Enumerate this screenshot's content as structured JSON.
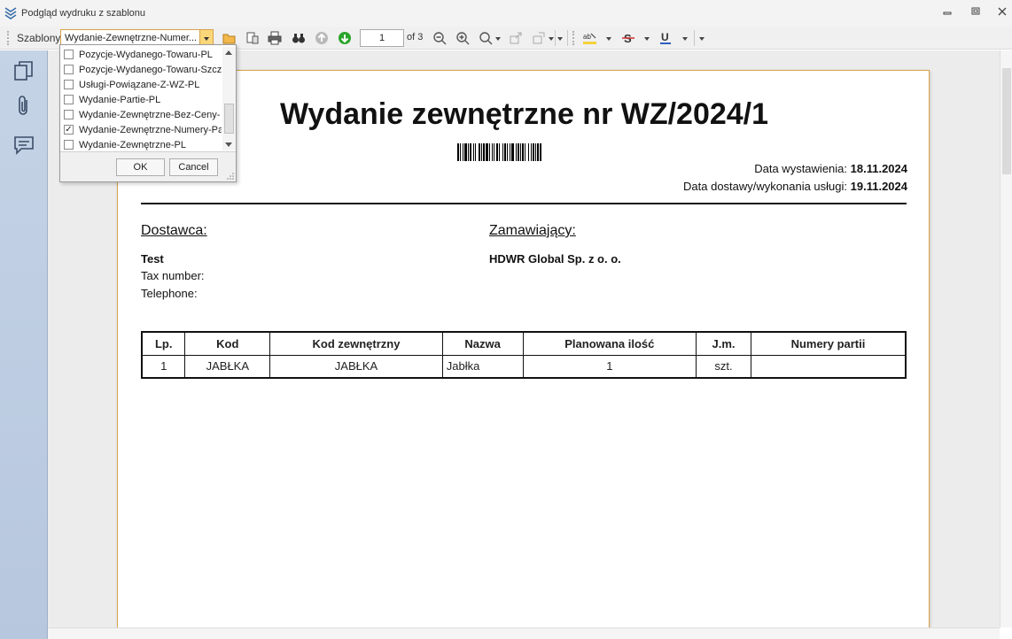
{
  "window": {
    "title": "Podgląd wydruku z szablonu"
  },
  "toolbar": {
    "templates_label": "Szablony",
    "selected_template": "Wydanie-Zewnętrzne-Numer...",
    "page_number": "1",
    "page_of": "of 3"
  },
  "dropdown": {
    "items": [
      {
        "label": "Pozycje-Wydanego-Towaru-PL",
        "checked": false
      },
      {
        "label": "Pozycje-Wydanego-Towaru-Szcz",
        "checked": false
      },
      {
        "label": "Usługi-Powiązane-Z-WZ-PL",
        "checked": false
      },
      {
        "label": "Wydanie-Partie-PL",
        "checked": false
      },
      {
        "label": "Wydanie-Zewnętrzne-Bez-Ceny-",
        "checked": false
      },
      {
        "label": "Wydanie-Zewnętrzne-Numery-Pa",
        "checked": true
      },
      {
        "label": "Wydanie-Zewnętrzne-PL",
        "checked": false
      }
    ],
    "ok_label": "OK",
    "cancel_label": "Cancel"
  },
  "document": {
    "title": "Wydanie zewnętrzne nr WZ/2024/1",
    "issue_date_label": "Data wystawienia:",
    "issue_date": "18.11.2024",
    "delivery_date_label": "Data dostawy/wykonania usługi:",
    "delivery_date": "19.11.2024",
    "supplier": {
      "heading": "Dostawca:",
      "name": "Test",
      "tax_label": "Tax number:",
      "phone_label": "Telephone:"
    },
    "buyer": {
      "heading": "Zamawiający:",
      "name": "HDWR Global Sp. z o. o."
    },
    "table": {
      "headers": [
        "Lp.",
        "Kod",
        "Kod zewnętrzny",
        "Nazwa",
        "Planowana ilość",
        "J.m.",
        "Numery partii"
      ],
      "rows": [
        [
          "1",
          "JABŁKA",
          "JABŁKA",
          "Jabłka",
          "1",
          "szt.",
          ""
        ]
      ]
    }
  },
  "colors": {
    "accent": "#d8a24a",
    "panel": "#b7c7de"
  }
}
